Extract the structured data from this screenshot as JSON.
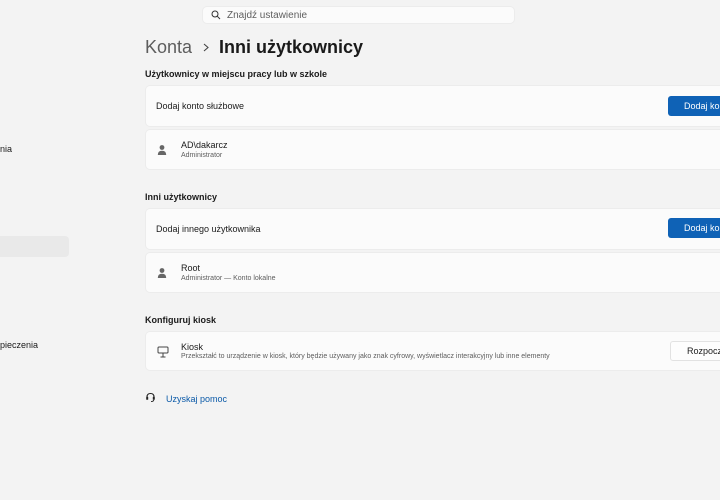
{
  "search": {
    "placeholder": "Znajdź ustawienie"
  },
  "sidebar": {
    "fragments": [
      "nia",
      "pieczenia"
    ]
  },
  "breadcrumb": {
    "parent": "Konta",
    "current": "Inni użytkownicy"
  },
  "work_school": {
    "title": "Użytkownicy w miejscu pracy lub w szkole",
    "add_label": "Dodaj konto służbowe",
    "add_button": "Dodaj konto",
    "user": {
      "name": "AD\\dakarcz",
      "role": "Administrator"
    }
  },
  "other_users": {
    "title": "Inni użytkownicy",
    "add_label": "Dodaj innego użytkownika",
    "add_button": "Dodaj konto",
    "user": {
      "name": "Root",
      "role": "Administrator — Konto lokalne"
    }
  },
  "kiosk": {
    "title": "Konfiguruj kiosk",
    "name": "Kiosk",
    "description": "Przekształć to urządzenie w kiosk, który będzie używany jako znak cyfrowy, wyświetlacz interakcyjny lub inne elementy",
    "button": "Rozpocznij"
  },
  "help": {
    "label": "Uzyskaj pomoc"
  },
  "colors": {
    "accent": "#0f62b6",
    "link": "#0b5aa8",
    "background": "#f3f3f3",
    "card": "#fbfbfb"
  }
}
